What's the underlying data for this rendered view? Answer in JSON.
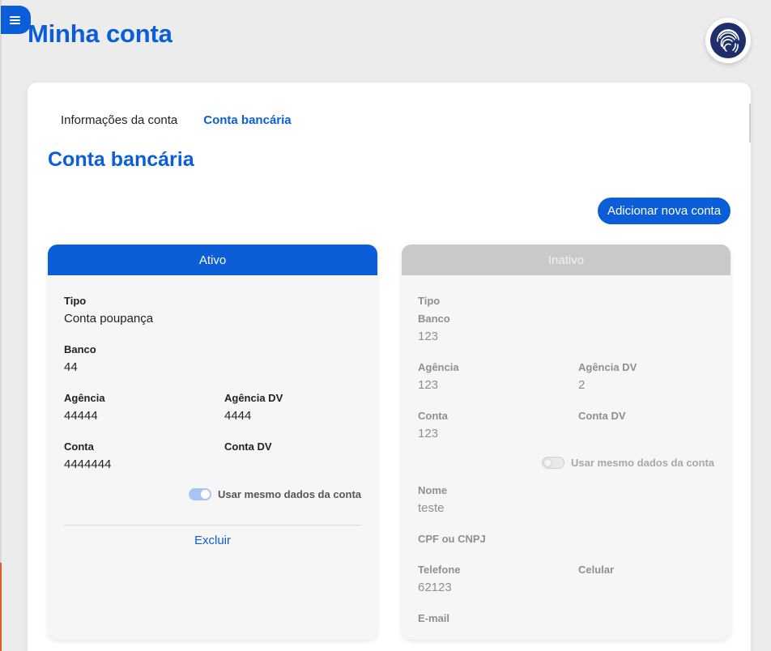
{
  "header": {
    "title": "Minha conta",
    "menu_icon": "hamburger-menu-icon",
    "avatar_icon": "fingerprint-icon"
  },
  "tabs": [
    {
      "label": "Informações da conta",
      "active": false
    },
    {
      "label": "Conta bancária",
      "active": true
    }
  ],
  "section": {
    "title": "Conta bancária",
    "add_button": "Adicionar nova conta"
  },
  "active_account": {
    "status": "Ativo",
    "tipo_label": "Tipo",
    "tipo_value": "Conta poupança",
    "banco_label": "Banco",
    "banco_value": "44",
    "agencia_label": "Agência",
    "agencia_value": "44444",
    "agencia_dv_label": "Agência DV",
    "agencia_dv_value": "4444",
    "conta_label": "Conta",
    "conta_value": "4444444",
    "conta_dv_label": "Conta DV",
    "conta_dv_value": "",
    "toggle_label": "Usar mesmo dados da conta",
    "toggle_on": true,
    "delete_label": "Excluir"
  },
  "inactive_account": {
    "status": "Inativo",
    "tipo_label": "Tipo",
    "tipo_value": "",
    "banco_label": "Banco",
    "banco_value": "123",
    "agencia_label": "Agência",
    "agencia_value": "123",
    "agencia_dv_label": "Agência DV",
    "agencia_dv_value": "2",
    "conta_label": "Conta",
    "conta_value": "123",
    "conta_dv_label": "Conta DV",
    "conta_dv_value": "",
    "toggle_label": "Usar mesmo dados da conta",
    "toggle_on": false,
    "nome_label": "Nome",
    "nome_value": "teste",
    "cpf_label": "CPF ou CNPJ",
    "cpf_value": "",
    "telefone_label": "Telefone",
    "telefone_value": "62123",
    "celular_label": "Celular",
    "celular_value": "",
    "email_label": "E-mail",
    "email_value": ""
  },
  "colors": {
    "primary": "#0b5ed7",
    "inactive_header": "#c9c9c9",
    "page_background": "#ececec"
  }
}
